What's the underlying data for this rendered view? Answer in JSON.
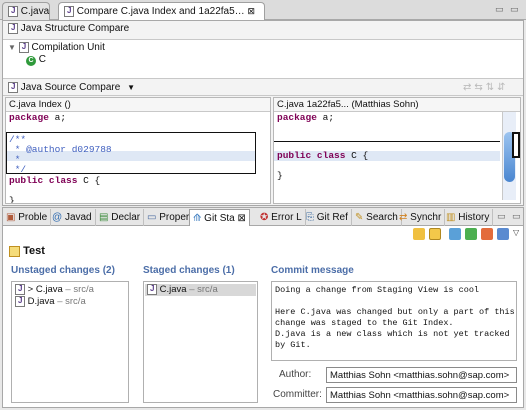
{
  "editor_tabs": [
    {
      "label": "C.java",
      "active": false
    },
    {
      "label": "Compare C.java Index and 1a22fa5…",
      "close": "⊠",
      "active": true
    }
  ],
  "structure": {
    "title": "Java Structure Compare",
    "tree_root": "Compilation Unit",
    "tree_child": "C"
  },
  "source_compare": {
    "title": "Java Source Compare",
    "dropdown": "▼",
    "left_title": "C.java Index ()",
    "right_title": "C.java 1a22fa5... (Matthias Sohn)",
    "left_lines": [
      "package a;",
      "",
      "/**",
      " * @author d029788",
      " *",
      " */",
      "public class C {",
      "",
      "}"
    ],
    "right_lines": [
      "package a;",
      "",
      "public class C {",
      "",
      "}"
    ]
  },
  "view_tabs": [
    {
      "label": "Proble"
    },
    {
      "label": "Javad"
    },
    {
      "label": "Declar"
    },
    {
      "label": "Proper"
    },
    {
      "label": "Git Sta",
      "close": "⊠",
      "active": true
    },
    {
      "label": "Error L"
    },
    {
      "label": "Git Ref"
    },
    {
      "label": "Search"
    },
    {
      "label": "Synchr"
    },
    {
      "label": "History"
    }
  ],
  "staging": {
    "repo_name": "Test",
    "unstaged_header": "Unstaged changes (2)",
    "staged_header": "Staged changes (1)",
    "commit_header": "Commit message",
    "unstaged": [
      {
        "name": "> C.java",
        "path": "– src/a"
      },
      {
        "name": "D.java",
        "path": "– src/a"
      }
    ],
    "staged": [
      {
        "name": "C.java",
        "path": "– src/a"
      }
    ],
    "commit_message": [
      "Doing a change from Staging View is cool",
      "",
      "Here C.java was changed but only a part of this",
      "change was staged to the Git Index.",
      "D.java is a new class which is not yet tracked",
      "by Git."
    ],
    "author_label": "Author:",
    "author_value": "Matthias Sohn <matthias.sohn@sap.com>",
    "committer_label": "Committer:",
    "committer_value": "Matthias Sohn <matthias.sohn@sap.com>"
  },
  "colors": {
    "section_header": "#4c6ea8",
    "keyword": "#7f0055",
    "comment": "#3f5fbf",
    "diff_highlight": "#dfe8f5"
  }
}
